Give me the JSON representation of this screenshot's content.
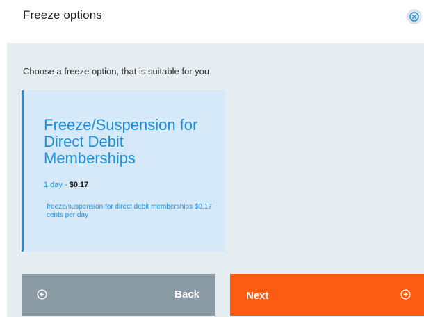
{
  "header": {
    "title": "Freeze options",
    "close_icon": "close-circle-icon"
  },
  "body": {
    "subtitle": "Choose a freeze option, that is suitable for you."
  },
  "option": {
    "title": "Freeze/Suspension for Direct Debit Memberships",
    "duration": "1 day",
    "separator": " - ",
    "price": "$0.17",
    "description": "freeze/suspension for direct debit memberships $0.17 cents per day"
  },
  "footer": {
    "back_label": "Back",
    "back_icon": "arrow-left-circle-icon",
    "next_label": "Next",
    "next_icon": "arrow-right-circle-icon"
  },
  "colors": {
    "accent_blue": "#1e8fd8",
    "card_bg": "#d5e9f8",
    "body_bg": "#e6edf1",
    "back_button": "#8b9ba6",
    "next_button": "#fb5c12"
  }
}
